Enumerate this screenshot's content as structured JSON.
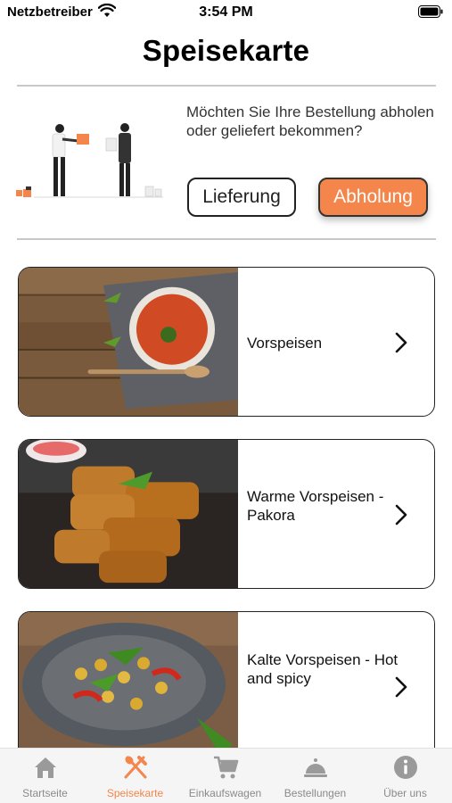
{
  "status_bar": {
    "carrier": "Netzbetreiber",
    "time": "3:54 PM"
  },
  "page": {
    "title": "Speisekarte"
  },
  "delivery": {
    "prompt": "Möchten Sie Ihre Bestellung abholen oder geliefert bekommen?",
    "delivery_label": "Lieferung",
    "pickup_label": "Abholung",
    "selected": "Abholung",
    "accent_color": "#f4854b"
  },
  "categories": [
    {
      "label": "Vorspeisen",
      "image": "tomato-soup-image"
    },
    {
      "label": "Warme Vorspeisen - Pakora",
      "image": "pakora-image"
    },
    {
      "label": "Kalte Vorspeisen - Hot and spicy",
      "image": "chickpea-salad-image"
    }
  ],
  "tabs": [
    {
      "label": "Startseite",
      "icon": "home-icon",
      "active": false
    },
    {
      "label": "Speisekarte",
      "icon": "fork-knife-icon",
      "active": true
    },
    {
      "label": "Einkaufswagen",
      "icon": "cart-icon",
      "active": false
    },
    {
      "label": "Bestellungen",
      "icon": "cloche-icon",
      "active": false
    },
    {
      "label": "Über uns",
      "icon": "info-icon",
      "active": false
    }
  ]
}
